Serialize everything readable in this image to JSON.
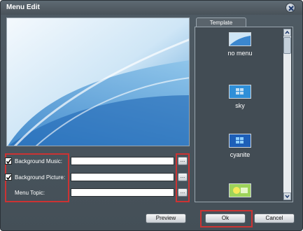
{
  "window": {
    "title": "Menu Edit",
    "close_icon": "close-icon"
  },
  "options": {
    "background_music": {
      "label": "Background Music:",
      "checked": true,
      "value": ""
    },
    "background_picture": {
      "label": "Background Picture:",
      "checked": true,
      "value": ""
    },
    "menu_topic": {
      "label": "Menu Topic:",
      "checked": false,
      "value": ""
    },
    "browse_label": "..."
  },
  "template": {
    "tab_label": "Template",
    "items": [
      {
        "name": "no menu"
      },
      {
        "name": "sky"
      },
      {
        "name": "cyanite"
      },
      {
        "name": ""
      }
    ]
  },
  "buttons": {
    "preview": "Preview",
    "ok": "Ok",
    "cancel": "Cancel"
  },
  "colors": {
    "window_bg": "#4a555d",
    "highlight": "#cc3333"
  }
}
